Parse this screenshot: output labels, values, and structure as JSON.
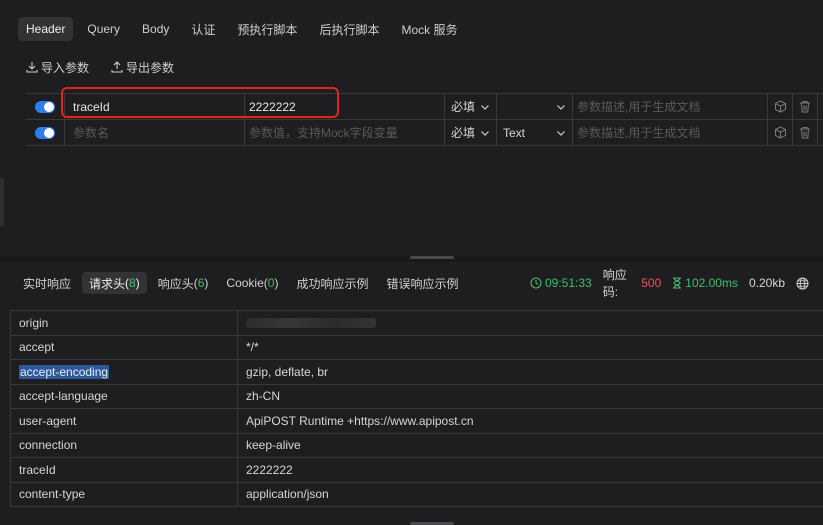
{
  "request_tabs": [
    {
      "label": "Header",
      "active": true
    },
    {
      "label": "Query"
    },
    {
      "label": "Body"
    },
    {
      "label": "认证"
    },
    {
      "label": "预执行脚本"
    },
    {
      "label": "后执行脚本"
    },
    {
      "label": "Mock 服务"
    }
  ],
  "actions": {
    "import_label": "导入参数",
    "export_label": "导出参数"
  },
  "params": [
    {
      "enabled": true,
      "name": "traceId",
      "value": "2222222",
      "required": "必填",
      "type": "",
      "desc_placeholder": "参数描述,用于生成文档"
    },
    {
      "enabled": true,
      "name": "",
      "name_placeholder": "参数名",
      "value": "",
      "value_placeholder": "参数值，支持Mock字段变量",
      "required": "必填",
      "type": "Text",
      "desc_placeholder": "参数描述,用于生成文档"
    }
  ],
  "response_tabs": [
    {
      "label": "实时响应"
    },
    {
      "label": "请求头",
      "count": "8",
      "active": true
    },
    {
      "label": "响应头",
      "count": "6"
    },
    {
      "label": "Cookie",
      "count": "0"
    },
    {
      "label": "成功响应示例"
    },
    {
      "label": "错误响应示例"
    }
  ],
  "status": {
    "time": "09:51:33",
    "code_label": "响应码:",
    "code": "500",
    "duration": "102.00ms",
    "size": "0.20kb"
  },
  "colors": {
    "accent": "#2f7cf6",
    "success": "#3fbf6a",
    "error": "#f0524a",
    "highlight": "#e0251c"
  },
  "headers": [
    {
      "key": "origin",
      "value": ""
    },
    {
      "key": "accept",
      "value": "*/*"
    },
    {
      "key": "accept-encoding",
      "value": "gzip, deflate, br"
    },
    {
      "key": "accept-language",
      "value": "zh-CN"
    },
    {
      "key": "user-agent",
      "value": "ApiPOST Runtime +https://www.apipost.cn"
    },
    {
      "key": "connection",
      "value": "keep-alive"
    },
    {
      "key": "traceId",
      "value": "2222222"
    },
    {
      "key": "content-type",
      "value": "application/json"
    }
  ]
}
